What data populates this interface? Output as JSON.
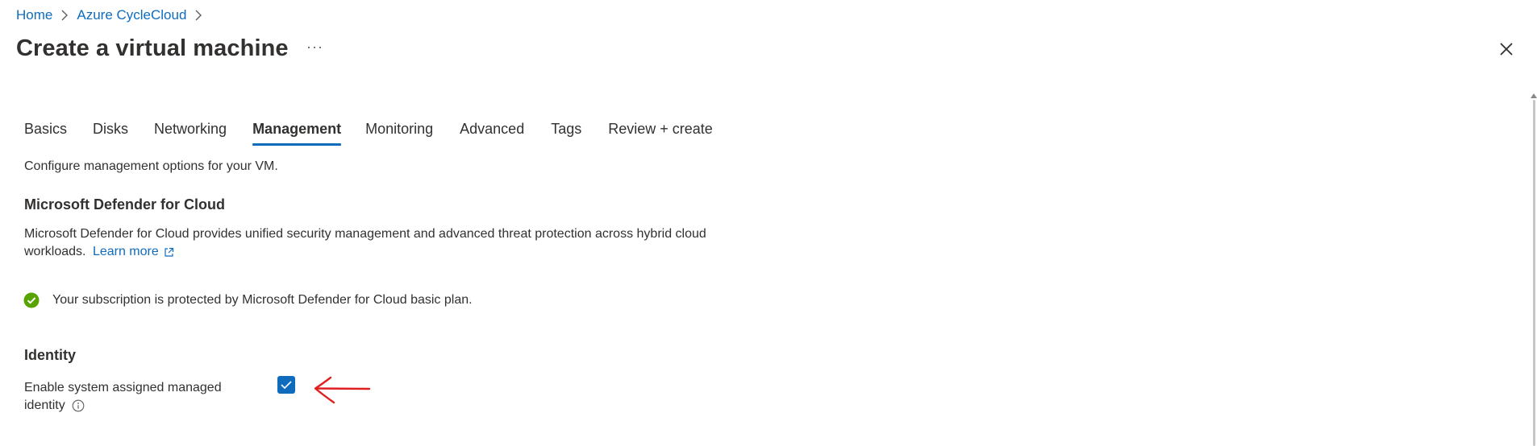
{
  "breadcrumb": {
    "items": [
      "Home",
      "Azure CycleCloud"
    ]
  },
  "header": {
    "title": "Create a virtual machine",
    "more_label": "···"
  },
  "tabs": [
    {
      "label": "Basics",
      "active": false
    },
    {
      "label": "Disks",
      "active": false
    },
    {
      "label": "Networking",
      "active": false
    },
    {
      "label": "Management",
      "active": true
    },
    {
      "label": "Monitoring",
      "active": false
    },
    {
      "label": "Advanced",
      "active": false
    },
    {
      "label": "Tags",
      "active": false
    },
    {
      "label": "Review + create",
      "active": false
    }
  ],
  "main": {
    "intro": "Configure management options for your VM.",
    "defender": {
      "heading": "Microsoft Defender for Cloud",
      "description": "Microsoft Defender for Cloud provides unified security management and advanced threat protection across hybrid cloud workloads.",
      "learn_more": "Learn more",
      "status": "Your subscription is protected by Microsoft Defender for Cloud basic plan."
    },
    "identity": {
      "heading": "Identity",
      "label": "Enable system assigned managed identity",
      "checked": true
    }
  },
  "colors": {
    "accent": "#0f6cbd",
    "success": "#57a300",
    "annotation": "#e02020"
  },
  "icons": {
    "breadcrumb_separator": "chevron-right-icon",
    "close": "close-icon",
    "external_link": "external-link-icon",
    "status": "success-check-icon",
    "info": "info-icon",
    "annotation": "red-arrow-icon"
  }
}
